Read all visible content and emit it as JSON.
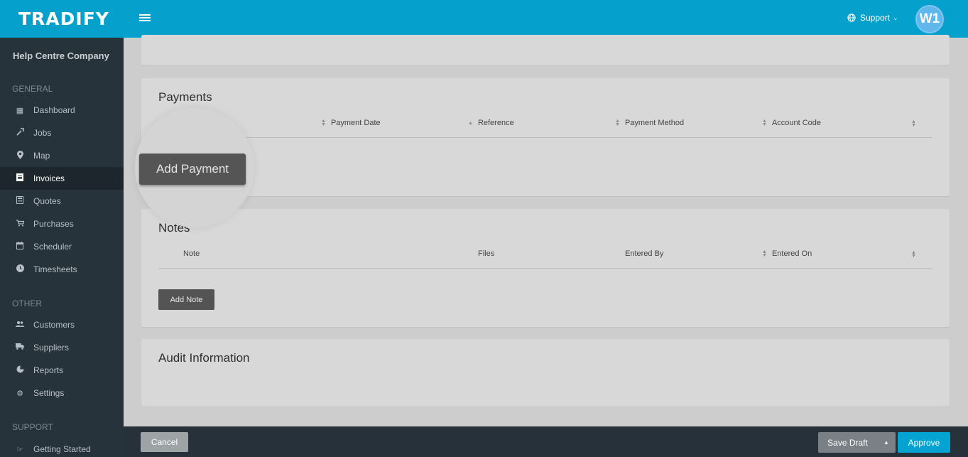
{
  "header": {
    "logo": "TRADIFY",
    "support_label": "Support",
    "support_chevron": "⌄",
    "avatar_initials": "W1"
  },
  "sidebar": {
    "company": "Help Centre Company",
    "sections": {
      "general": "GENERAL",
      "other": "OTHER",
      "support": "SUPPORT"
    },
    "items": [
      {
        "label": "Dashboard",
        "icon": "dashboard-icon",
        "glyph": "▦"
      },
      {
        "label": "Jobs",
        "icon": "wrench-icon",
        "glyph": "🔧"
      },
      {
        "label": "Map",
        "icon": "map-marker-icon",
        "glyph": "⚲"
      },
      {
        "label": "Invoices",
        "icon": "invoice-icon",
        "glyph": "▤"
      },
      {
        "label": "Quotes",
        "icon": "calculator-icon",
        "glyph": "▦"
      },
      {
        "label": "Purchases",
        "icon": "cart-icon",
        "glyph": "⛟"
      },
      {
        "label": "Scheduler",
        "icon": "calendar-icon",
        "glyph": "▣"
      },
      {
        "label": "Timesheets",
        "icon": "clock-icon",
        "glyph": "◷"
      },
      {
        "label": "Customers",
        "icon": "users-icon",
        "glyph": "👥"
      },
      {
        "label": "Suppliers",
        "icon": "truck-icon",
        "glyph": "⛟"
      },
      {
        "label": "Reports",
        "icon": "pie-chart-icon",
        "glyph": "◔"
      },
      {
        "label": "Settings",
        "icon": "gear-icon",
        "glyph": "⚙"
      },
      {
        "label": "Getting Started",
        "icon": "pointer-icon",
        "glyph": "☞"
      }
    ],
    "active": "Invoices"
  },
  "payments": {
    "title": "Payments",
    "columns": [
      "Payment Date",
      "Reference",
      "Payment Method",
      "Account Code"
    ],
    "add_button": "Add Payment"
  },
  "notes": {
    "title": "Notes",
    "columns": [
      "Note",
      "Files",
      "Entered By",
      "Entered On"
    ],
    "add_button": "Add Note"
  },
  "audit": {
    "title": "Audit Information"
  },
  "footer": {
    "cancel": "Cancel",
    "save_draft": "Save Draft",
    "save_draft_caret": "▲",
    "approve": "Approve"
  },
  "colors": {
    "brand": "#05a1cc",
    "sidebar": "#27333b",
    "approve": "#04a3d2"
  }
}
